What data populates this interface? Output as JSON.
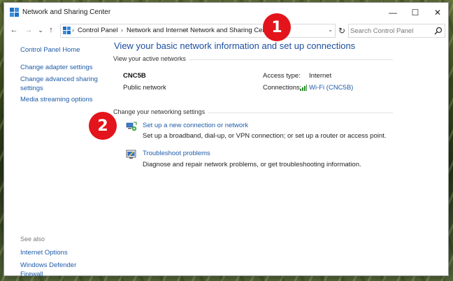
{
  "window": {
    "title": "Network and Sharing Center"
  },
  "caption": {
    "minimize": "—",
    "maximize": "☐",
    "close": "✕"
  },
  "nav": {
    "back": "←",
    "forward": "→",
    "recent": "⌄",
    "up": "↑",
    "refresh": "↻",
    "dropdown": "⌄"
  },
  "breadcrumb": {
    "items": [
      "Control Panel",
      "Network and Internet",
      "Network and Sharing Center"
    ],
    "separator": "›"
  },
  "search": {
    "placeholder": "Search Control Panel"
  },
  "sidebar": {
    "links": [
      "Control Panel Home",
      "Change adapter settings",
      "Change advanced sharing settings",
      "Media streaming options"
    ],
    "see_also_label": "See also",
    "see_also_links": [
      "Internet Options",
      "Windows Defender Firewall"
    ]
  },
  "main": {
    "title": "View your basic network information and set up connections",
    "active_networks_label": "View your active networks",
    "network": {
      "name": "CNC5B",
      "type": "Public network",
      "access_type_label": "Access type:",
      "access_type_value": "Internet",
      "connections_label": "Connections:",
      "connections_value": "Wi-Fi (CNC5B)"
    },
    "change_settings_label": "Change your networking settings",
    "tasks": [
      {
        "icon": "network-setup-icon",
        "link": "Set up a new connection or network",
        "description": "Set up a broadband, dial-up, or VPN connection; or set up a router or access point."
      },
      {
        "icon": "troubleshoot-icon",
        "link": "Troubleshoot problems",
        "description": "Diagnose and repair network problems, or get troubleshooting information."
      }
    ]
  },
  "callouts": [
    "1",
    "2"
  ],
  "colors": {
    "link": "#1e5ca8",
    "title": "#1c4ea0",
    "callout": "#e3141b"
  }
}
